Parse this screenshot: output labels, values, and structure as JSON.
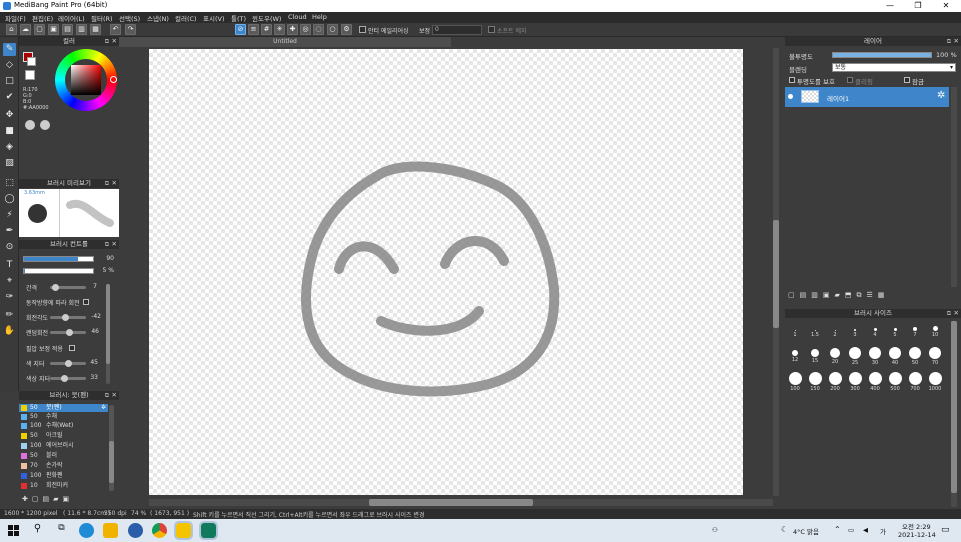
{
  "window": {
    "title": "MediBang Paint Pro (64bit)",
    "controls": [
      "—",
      "❐",
      "✕"
    ]
  },
  "menu": [
    "파일(F)",
    "편집(E)",
    "레이어(L)",
    "필터(R)",
    "선택(S)",
    "스냅(N)",
    "컬러(C)",
    "표시(V)",
    "툴(T)",
    "윈도우(W)",
    "Cloud",
    "Help"
  ],
  "toolbar": {
    "antialias_label": "안티 에일리어싱",
    "correction_label": "보정",
    "correction_value": "0",
    "soft_edge_label": "소프트 에지"
  },
  "canvas": {
    "tab_title": "Untitled"
  },
  "color_panel": {
    "title": "컬러",
    "r": "R:170",
    "g": "G:0",
    "b": "B:0",
    "hex": "#:AA0000",
    "primary_color": "#aa0000"
  },
  "brush_preview": {
    "title": "브러시 미리보기",
    "size_label": "3.63mm"
  },
  "brush_control": {
    "title": "브러시 컨트롤",
    "size_value": "90",
    "opacity_value": "5 %",
    "spacing_label": "간격",
    "spacing_value": "7",
    "rotate_dir_label": "동작방향에 따라 회전",
    "angle_label": "회전각도",
    "angle_value": "-42",
    "random_rotate_label": "랜덤회전",
    "random_rotate_value": "46",
    "pressure_label": "필압 보정 적용",
    "hue_jitter_label": "색 지터",
    "hue_jitter_value": "45",
    "sat_jitter_label": "색상 지터",
    "sat_jitter_value": "33",
    "size_fill": 0.78
  },
  "brush_list": {
    "title": "브러시: 붓(펜)",
    "items": [
      {
        "size": "50",
        "name": "붓(펜)",
        "color": "#f0d000"
      },
      {
        "size": "50",
        "name": "수채",
        "color": "#5ab0f0"
      },
      {
        "size": "100",
        "name": "수채(Wet)",
        "color": "#5ab0f0"
      },
      {
        "size": "50",
        "name": "아크릴",
        "color": "#f0d000"
      },
      {
        "size": "100",
        "name": "에어브러시",
        "color": "#a0d0f0"
      },
      {
        "size": "50",
        "name": "블러",
        "color": "#e070e0"
      },
      {
        "size": "70",
        "name": "손가락",
        "color": "#f0c0a0"
      },
      {
        "size": "100",
        "name": "판화펜",
        "color": "#3060e0"
      },
      {
        "size": "10",
        "name": "회전마커",
        "color": "#e03030"
      }
    ]
  },
  "layer_panel": {
    "title": "레이어",
    "opacity_label": "불투명도",
    "opacity_value": "100 %",
    "opacity_fill": 1.0,
    "blend_label": "블렌딩",
    "blend_value": "보통",
    "protect_label": "투명도를 보호",
    "clipping_label": "클리핑",
    "lock_label": "잠금",
    "layer_name": "레이어1"
  },
  "brush_size_panel": {
    "title": "브러시 사이즈",
    "sizes": [
      "1",
      "1.5",
      "2",
      "3",
      "4",
      "5",
      "7",
      "10",
      "12",
      "15",
      "20",
      "25",
      "30",
      "40",
      "50",
      "70",
      "100",
      "150",
      "200",
      "300",
      "400",
      "500",
      "700",
      "1000"
    ]
  },
  "statusbar": {
    "size": "1600 * 1200 pixel",
    "cm": "( 11.6 * 8.7cm )",
    "dpi": "350 dpi",
    "zoom": "74 %",
    "coords": "( 1673, 951 )",
    "hint": "Shift 키를 누르면서 직선 그리기, Ctrl+Alt키를 누르면서 좌우 드래그로 브러시 사이즈 변경"
  },
  "taskbar": {
    "weather": "4°C 맑음",
    "time": "오전 2:29",
    "date": "2021-12-14"
  }
}
